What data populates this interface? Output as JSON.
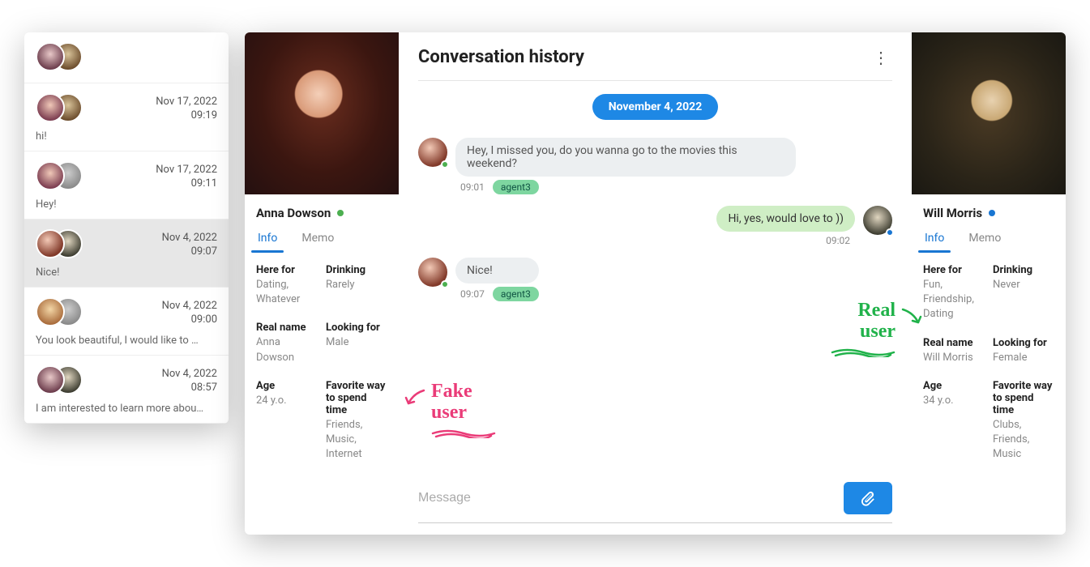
{
  "sidebar": {
    "items": [
      {
        "date": "",
        "time": "",
        "preview": ""
      },
      {
        "date": "Nov 17, 2022",
        "time": "09:19",
        "preview": "hi!"
      },
      {
        "date": "Nov 17, 2022",
        "time": "09:11",
        "preview": "Hey!"
      },
      {
        "date": "Nov 4, 2022",
        "time": "09:07",
        "preview": "Nice!"
      },
      {
        "date": "Nov 4, 2022",
        "time": "09:00",
        "preview": "You look beautiful, I would like to …"
      },
      {
        "date": "Nov 4, 2022",
        "time": "08:57",
        "preview": "I am interested to learn more abou…"
      }
    ]
  },
  "chat": {
    "title": "Conversation history",
    "date_pill": "November 4, 2022",
    "messages": [
      {
        "side": "left",
        "text": "Hey, I missed you, do you wanna go to the movies this weekend?",
        "time": "09:01",
        "agent": "agent3"
      },
      {
        "side": "right",
        "text": "Hi, yes, would love to ))",
        "time": "09:02"
      },
      {
        "side": "left",
        "text": "Nice!",
        "time": "09:07",
        "agent": "agent3"
      }
    ],
    "composer_placeholder": "Message"
  },
  "left_profile": {
    "name": "Anna Dowson",
    "tabs": {
      "info": "Info",
      "memo": "Memo"
    },
    "fields": {
      "here_for": {
        "label": "Here for",
        "value": "Dating, Whatever"
      },
      "drinking": {
        "label": "Drinking",
        "value": "Rarely"
      },
      "real_name": {
        "label": "Real name",
        "value": "Anna Dowson"
      },
      "looking_for": {
        "label": "Looking for",
        "value": "Male"
      },
      "age": {
        "label": "Age",
        "value": "24 y.o."
      },
      "fav_time": {
        "label": "Favorite way to spend time",
        "value": "Friends, Music, Internet"
      }
    }
  },
  "right_profile": {
    "name": "Will Morris",
    "tabs": {
      "info": "Info",
      "memo": "Memo"
    },
    "fields": {
      "here_for": {
        "label": "Here for",
        "value": "Fun, Friendship, Dating"
      },
      "drinking": {
        "label": "Drinking",
        "value": "Never"
      },
      "real_name": {
        "label": "Real name",
        "value": "Will Morris"
      },
      "looking_for": {
        "label": "Looking for",
        "value": "Female"
      },
      "age": {
        "label": "Age",
        "value": "34 y.o."
      },
      "fav_time": {
        "label": "Favorite way to spend time",
        "value": "Clubs, Friends, Music"
      }
    }
  },
  "annotations": {
    "fake": "Fake user",
    "real": "Real user"
  }
}
